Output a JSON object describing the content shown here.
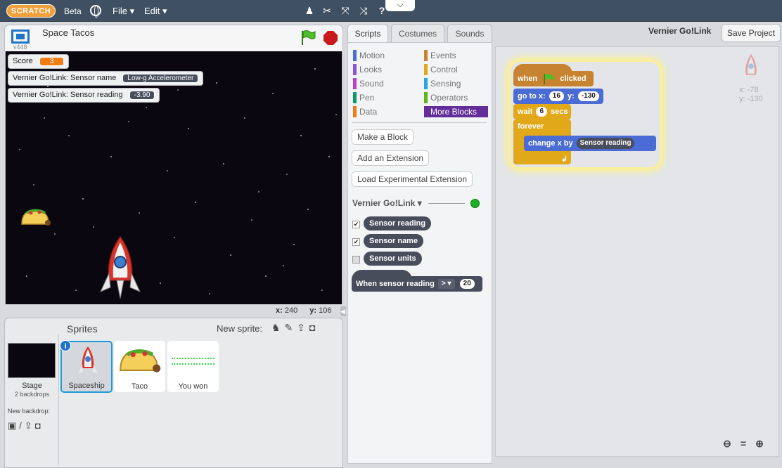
{
  "topbar": {
    "logo": "SCRATCH",
    "beta": "Beta",
    "menus": [
      "File",
      "Edit"
    ],
    "tools": [
      "duplicate-icon",
      "cut-icon",
      "grow-icon",
      "shrink-icon",
      "help-icon"
    ]
  },
  "stage": {
    "title": "Space Tacos",
    "version": "v448",
    "monitors": {
      "score_label": "Score",
      "score_value": "3",
      "sensor_name_label": "Vernier Go!Link: Sensor name",
      "sensor_name_value": "Low-g Accelerometer",
      "sensor_reading_label": "Vernier Go!Link: Sensor reading",
      "sensor_reading_value": "-3.90"
    },
    "coords": {
      "x_label": "x:",
      "x": "240",
      "y_label": "y:",
      "y": "106"
    }
  },
  "sprites": {
    "title": "Sprites",
    "new_sprite": "New sprite:",
    "stage_label": "Stage",
    "backdrops": "2 backdrops",
    "new_backdrop": "New backdrop:",
    "list": [
      {
        "name": "Spaceship"
      },
      {
        "name": "Taco"
      },
      {
        "name": "You won"
      }
    ]
  },
  "tabs": [
    "Scripts",
    "Costumes",
    "Sounds"
  ],
  "palette": {
    "categories": [
      {
        "label": "Motion",
        "color": "#4a6cd4"
      },
      {
        "label": "Looks",
        "color": "#8a55d7"
      },
      {
        "label": "Sound",
        "color": "#bb42c3"
      },
      {
        "label": "Pen",
        "color": "#0e9a6c"
      },
      {
        "label": "Data",
        "color": "#ee7d16"
      },
      {
        "label": "Events",
        "color": "#c88330"
      },
      {
        "label": "Control",
        "color": "#e1a91a"
      },
      {
        "label": "Sensing",
        "color": "#2ca5e2"
      },
      {
        "label": "Operators",
        "color": "#5cb712"
      },
      {
        "label": "More Blocks",
        "color": "#632d99"
      }
    ],
    "make_block": "Make a Block",
    "add_extension": "Add an Extension",
    "load_experimental": "Load Experimental Extension",
    "extension_name": "Vernier Go!Link",
    "reporters": [
      "Sensor reading",
      "Sensor name",
      "Sensor units"
    ],
    "hat": {
      "label": "When sensor reading",
      "op": ">",
      "value": "20"
    }
  },
  "header": {
    "owner": "Vernier Go!Link",
    "save": "Save Project"
  },
  "script": {
    "when": "when",
    "clicked": "clicked",
    "goto_label": "go to x:",
    "goto_x": "16",
    "goto_y_label": "y:",
    "goto_y": "-130",
    "wait_label": "wait",
    "wait_val": "6",
    "wait_secs": "secs",
    "forever": "forever",
    "change_label": "change x by",
    "change_val": "Sensor reading",
    "sprite_x": "x: -78",
    "sprite_y": "y: -130"
  }
}
